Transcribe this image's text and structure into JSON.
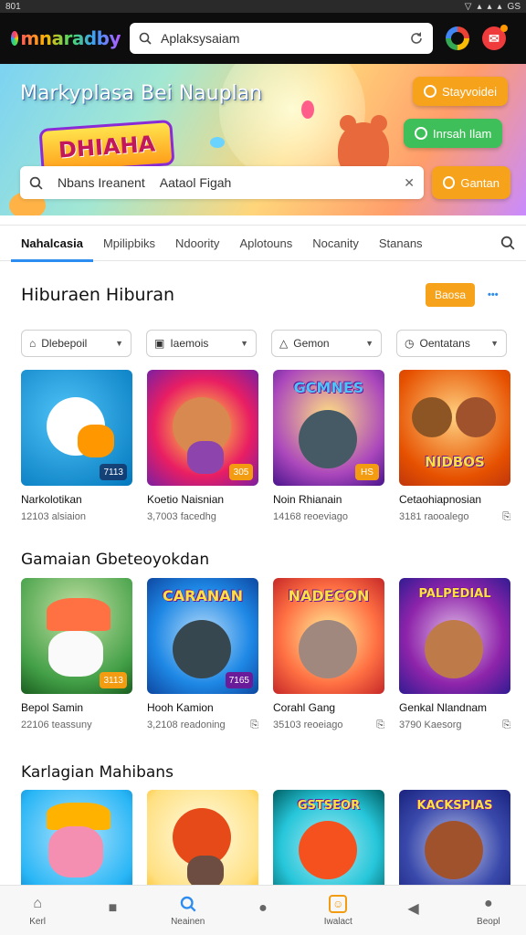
{
  "status_bar": {
    "time": "801",
    "icons": [
      "wifi-icon",
      "signal-icon",
      "signal-icon",
      "signal-icon",
      "gs-text"
    ],
    "network_label": "GS"
  },
  "app": {
    "logo_text": "mnaradby"
  },
  "top_search": {
    "value": "Aplaksysaiam"
  },
  "hero": {
    "title": "Markyplasa Bei Nauplan",
    "game_logo": "DHIAHA",
    "btn_orange": "Stayvoidei",
    "btn_green": "Inrsah Ilam",
    "search_left": "Nbans Ireanent",
    "search_right": "Aataol Figah",
    "search_button": "Gantan"
  },
  "tabs": [
    {
      "label": "Nahalcasia",
      "active": true
    },
    {
      "label": "Mpilipbiks",
      "active": false
    },
    {
      "label": "Ndoority",
      "active": false
    },
    {
      "label": "Aplotouns",
      "active": false
    },
    {
      "label": "Nocanity",
      "active": false
    },
    {
      "label": "Stanans",
      "active": false
    }
  ],
  "section1": {
    "title": "Hiburaen Hiburan",
    "see_all": "Baosa",
    "more": "•••",
    "filters": [
      "Dlebepoil",
      "Iaemois",
      "Gemon",
      "Oentatans"
    ],
    "cards": [
      {
        "name": "Narkolotikan",
        "meta": "12103 alsiaion",
        "tag": "7113",
        "meta_icon": ""
      },
      {
        "name": "Koetio Naisnian",
        "meta": "3,7003 facedhg",
        "tag": "305",
        "meta_icon": ""
      },
      {
        "name": "Noin Rhianain",
        "meta": "14168 reoeviago",
        "tag": "HS",
        "meta_icon": ""
      },
      {
        "name": "Cetaohiapnosian",
        "meta": "3181 raooalego",
        "tag": "",
        "meta_icon": "⎘",
        "art": "NIDBOS"
      }
    ]
  },
  "section2": {
    "title": "Gamaian Gbeteoyokdan",
    "cards": [
      {
        "name": "Bepol Samin",
        "meta": "22106 teassuny",
        "tag": "3113",
        "meta_icon": ""
      },
      {
        "name": "Hooh Kamion",
        "meta": "3,2108 readoning",
        "tag": "7165",
        "meta_icon": "⎘",
        "art": "CARANAN"
      },
      {
        "name": "Corahl Gang",
        "meta": "35103 reoeiago",
        "tag": "",
        "meta_icon": "⎘",
        "art": "NADECON"
      },
      {
        "name": "Genkal Nlandnam",
        "meta": "3790 Kaesorg",
        "tag": "",
        "meta_icon": "⎘",
        "art": "PALPEDIAL"
      }
    ]
  },
  "section3": {
    "title": "Karlagian Mahibans",
    "cards": [
      {
        "name": "",
        "art": ""
      },
      {
        "name": "",
        "art": ""
      },
      {
        "name": "",
        "art": "GSTSEOR"
      },
      {
        "name": "",
        "art": "KACKSPIAS"
      }
    ]
  },
  "bottom_nav": [
    {
      "label": "Kerl",
      "icon": "home-icon",
      "active": false
    },
    {
      "label": "",
      "icon": "grid-icon",
      "active": false
    },
    {
      "label": "Neainen",
      "icon": "search-icon",
      "active": true
    },
    {
      "label": "",
      "icon": "chat-icon",
      "active": false
    },
    {
      "label": "Iwalact",
      "icon": "store-icon",
      "active": false
    },
    {
      "label": "",
      "icon": "back-icon",
      "active": false
    },
    {
      "label": "Beopl",
      "icon": "profile-icon",
      "active": false
    }
  ],
  "colors": {
    "accent": "#f7a21b",
    "green": "#3fbf5a",
    "blue": "#2d8cf0",
    "topbar": "#0d0d0d"
  }
}
